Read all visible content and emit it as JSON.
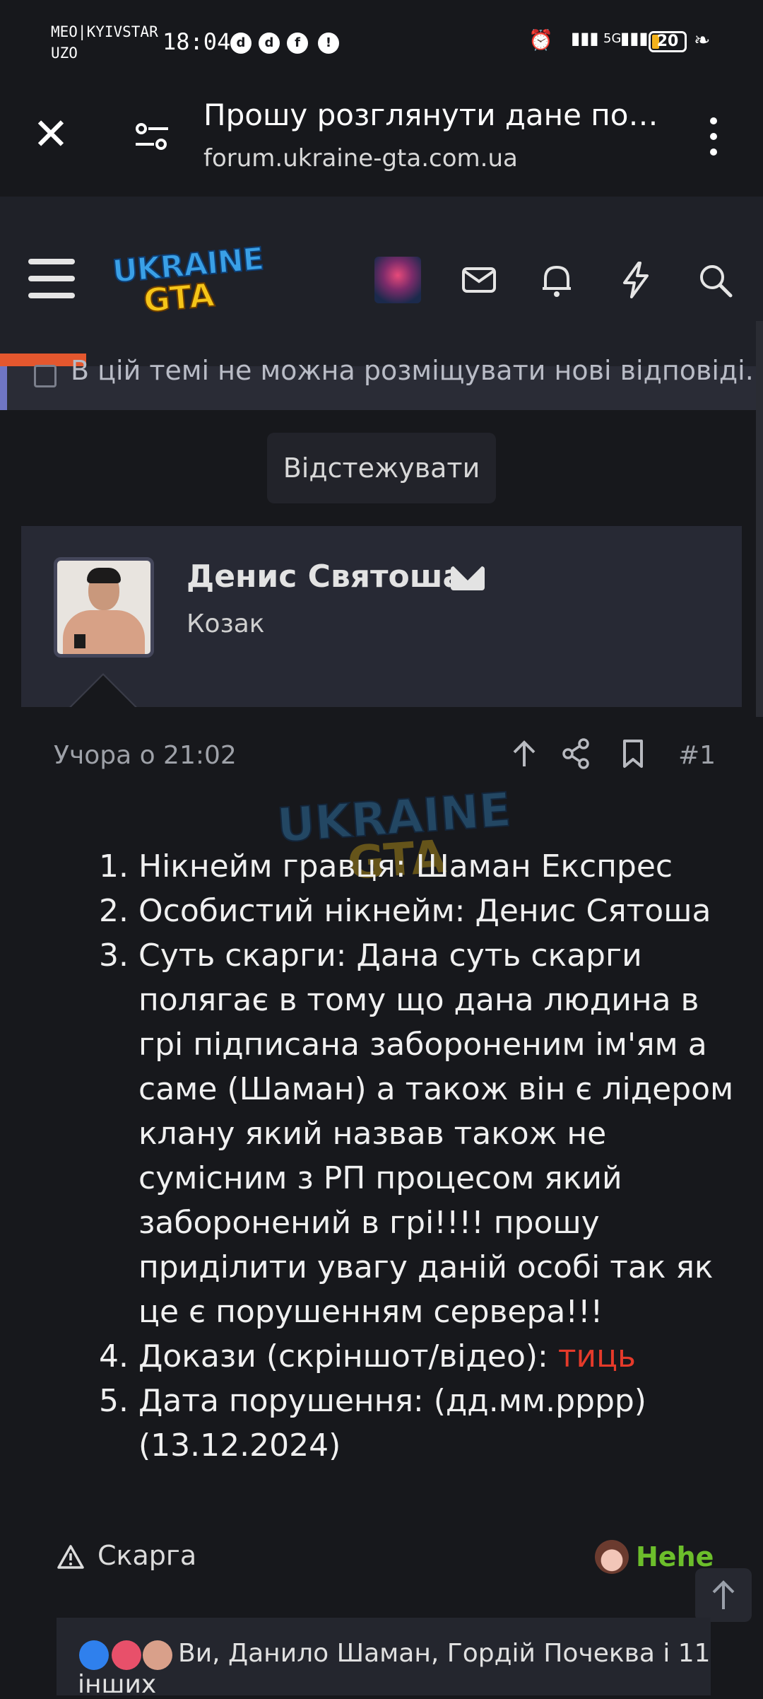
{
  "status_bar": {
    "carrier_line1": "MEO|KYIVSTAR",
    "carrier_line2": "UZO",
    "time": "18:04",
    "signal_label": "5G",
    "battery": "20"
  },
  "browser": {
    "page_title": "Прошу розглянути дане пор...",
    "url": "forum.ukraine-gta.com.ua"
  },
  "forum_header": {
    "logo_top": "UKRAINE",
    "logo_bottom": "GTA"
  },
  "notice": {
    "text": "В цій темі не можна розміщувати нові відповіді."
  },
  "watch_button": "Відстежувати",
  "post": {
    "author": "Денис Святоша",
    "author_title": "Козак",
    "date": "Учора о 21:02",
    "number": "#1",
    "items": [
      {
        "n": "1.",
        "text": "Нікнейм гравця: Шаман Експрес"
      },
      {
        "n": "2.",
        "text": "Особистий нікнейм: Денис Сятоша"
      },
      {
        "n": "3.",
        "text": "Суть скарги: Дана суть скарги полягає в тому що дана людина в грі підписана забороненим ім'ям а саме (Шаман) а також він є лідером клану який назвав також не сумісним з РП процесом який заборонений в грі!!!! прошу приділити увагу даній особі так як це є порушенням сервера!!!"
      },
      {
        "n": "4.",
        "text": "Докази (скріншот/відео): ",
        "link": "тиць"
      },
      {
        "n": "5.",
        "text": "Дата порушення: (дд.мм.рррр) (13.12.2024)"
      }
    ],
    "report_label": "Скарга",
    "reaction_user": "Hehe",
    "reactions_text_line1": "Ви, Данило Шаман, Гордій Почеква і 11",
    "reactions_text_line2": "інших"
  }
}
